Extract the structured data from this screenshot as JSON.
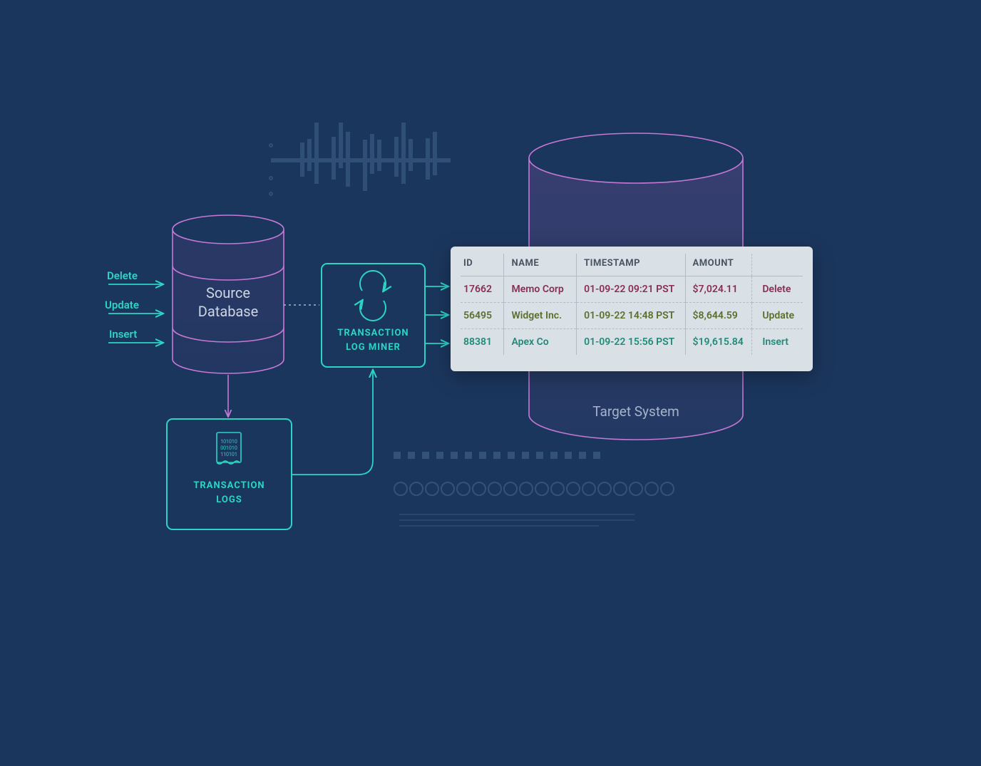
{
  "operations": [
    {
      "label": "Delete",
      "color": "#8a2d56"
    },
    {
      "label": "Update",
      "color": "#5b6f2d"
    },
    {
      "label": "Insert",
      "color": "#1f8a77"
    }
  ],
  "source_db_label": "Source\nDatabase",
  "tx_logs_label": "TRANSACTION\nLOGS",
  "tx_miner_label": "TRANSACTION\nLOG MINER",
  "target_label": "Target System",
  "table": {
    "headers": [
      "ID",
      "NAME",
      "TIMESTAMP",
      "AMOUNT"
    ],
    "rows": [
      {
        "id": "17662",
        "name": "Memo Corp",
        "ts": "01-09-22 09:21 PST",
        "amt": "$7,024.11",
        "op": "Delete",
        "cls": "row-delete"
      },
      {
        "id": "56495",
        "name": "Widget Inc.",
        "ts": "01-09-22 14:48 PST",
        "amt": "$8,644.59",
        "op": "Update",
        "cls": "row-update"
      },
      {
        "id": "88381",
        "name": "Apex Co",
        "ts": "01-09-22 15:56 PST",
        "amt": "$19,615.84",
        "op": "Insert",
        "cls": "row-insert"
      }
    ]
  }
}
